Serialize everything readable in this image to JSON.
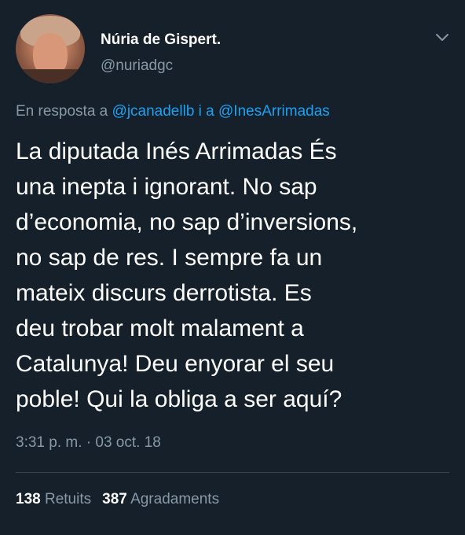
{
  "author": {
    "display_name": "Núria de Gispert.",
    "handle": "@nuriadgc"
  },
  "reply": {
    "prefix": "En resposta a ",
    "mention1": "@jcanadellb",
    "connector": " i a ",
    "mention2": "@InesArrimadas"
  },
  "tweet": {
    "lines": [
      "La diputada Inés Arrimadas És",
      "una inepta i ignorant. No sap",
      "d’economia, no sap d’inversions,",
      "no sap de res. I sempre fa un",
      "mateix discurs derrotista. Es",
      "deu trobar molt malament a",
      "Catalunya! Deu enyorar el seu",
      "poble! Qui la obliga a ser aquí?"
    ],
    "timestamp": "3:31 p. m. · 03 oct. 18"
  },
  "stats": {
    "retweets_count": "138",
    "retweets_label": "Retuits",
    "likes_count": "387",
    "likes_label": "Agradaments"
  },
  "icons": {
    "menu": "chevron-down-icon"
  },
  "colors": {
    "background": "#15202b",
    "text_primary": "#ffffff",
    "text_secondary": "#8899a6",
    "link": "#1da1f2",
    "divider": "#38444d"
  }
}
